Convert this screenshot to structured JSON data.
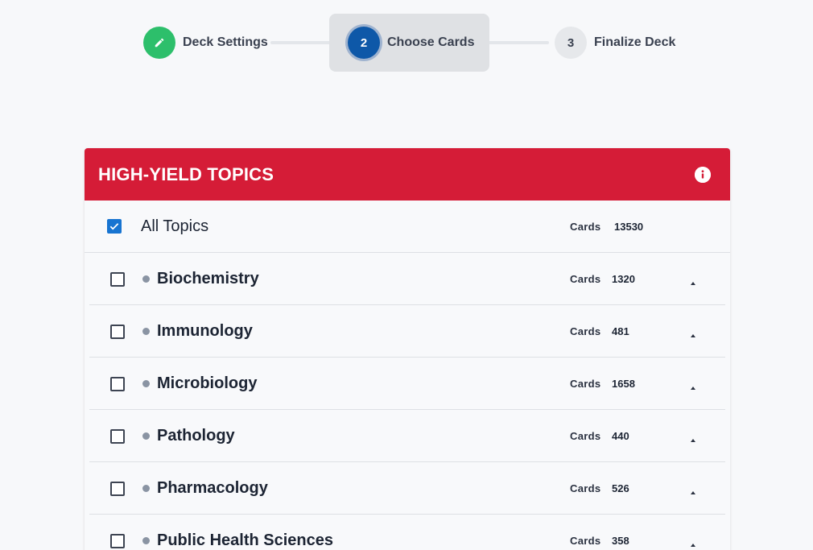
{
  "stepper": {
    "steps": [
      {
        "number": "",
        "label": "Deck Settings",
        "state": "complete",
        "icon": "pencil-icon"
      },
      {
        "number": "2",
        "label": "Choose Cards",
        "state": "active"
      },
      {
        "number": "3",
        "label": "Finalize Deck",
        "state": "pending"
      }
    ]
  },
  "panel": {
    "title": "HIGH-YIELD TOPICS",
    "info_icon": "info-icon",
    "accent_color": "#d51c37",
    "all_topics": {
      "label": "All Topics",
      "cards_label": "Cards",
      "cards_count": "13530",
      "checked": true
    },
    "topics": [
      {
        "label": "Biochemistry",
        "cards_label": "Cards",
        "cards_count": "1320",
        "checked": false
      },
      {
        "label": "Immunology",
        "cards_label": "Cards",
        "cards_count": "481",
        "checked": false
      },
      {
        "label": "Microbiology",
        "cards_label": "Cards",
        "cards_count": "1658",
        "checked": false
      },
      {
        "label": "Pathology",
        "cards_label": "Cards",
        "cards_count": "440",
        "checked": false
      },
      {
        "label": "Pharmacology",
        "cards_label": "Cards",
        "cards_count": "526",
        "checked": false
      },
      {
        "label": "Public Health Sciences",
        "cards_label": "Cards",
        "cards_count": "358",
        "checked": false
      }
    ]
  }
}
